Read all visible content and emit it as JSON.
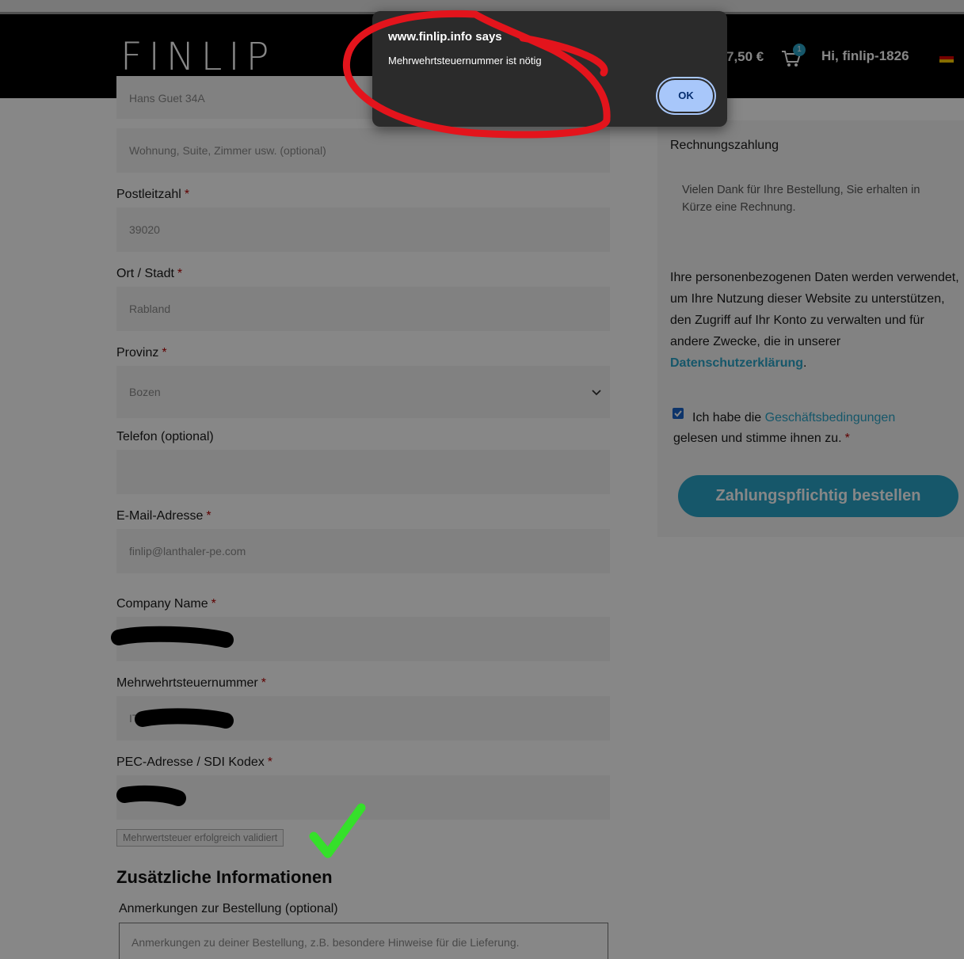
{
  "header": {
    "logo": "FINLIP",
    "cart_total": "7,50 €",
    "cart_count": "1",
    "greeting": "Hi, finlip-1826",
    "language_flag": "german-flag-icon"
  },
  "form": {
    "address_line1_value": "Hans Guet 34A",
    "address_line2_placeholder": "Wohnung, Suite, Zimmer usw. (optional)",
    "postcode_label": "Postleitzahl",
    "postcode_value": "39020",
    "city_label": "Ort / Stadt",
    "city_value": "Rabland",
    "province_label": "Provinz",
    "province_value": "Bozen",
    "phone_label": "Telefon (optional)",
    "email_label": "E-Mail-Adresse",
    "email_value": "finlip@lanthaler-pe.com",
    "company_label": "Company Name",
    "vat_label": "Mehrwehrtsteuernummer",
    "vat_value_prefix": "IT",
    "pec_label": "PEC-Adresse / SDI Kodex",
    "required_mark": "*",
    "validation_badge": "Mehrwertsteuer erfolgreich validiert",
    "additional_title": "Zusätzliche Informationen",
    "notes_label": "Anmerkungen zur Bestellung (optional)",
    "notes_placeholder": "Anmerkungen zu deiner Bestellung, z.B. besondere Hinweise für die Lieferung."
  },
  "sidebar": {
    "payment_title": "Rechnungszahlung",
    "payment_desc": "Vielen Dank für Ihre Bestellung, Sie erhalten in Kürze eine Rechnung.",
    "privacy_text": "Ihre personenbezogenen Daten werden verwendet, um Ihre Nutzung dieser Website zu unterstützen, den Zugriff auf Ihr Konto zu verwalten und für andere Zwecke, die in unserer",
    "privacy_link": "Datenschutzerklärung",
    "privacy_end": ".",
    "terms_prefix": "Ich habe die",
    "terms_link": "Geschäftsbedingungen",
    "terms_suffix": "gelesen und stimme ihnen zu.",
    "order_button": "Zahlungspflichtig bestellen"
  },
  "dialog": {
    "title": "www.finlip.info says",
    "message": "Mehrwehrtsteuernummer ist nötig",
    "ok_label": "OK"
  },
  "colors": {
    "accent": "#2aa4c8",
    "header_bg": "#000000",
    "annotation_red": "#e3141c",
    "annotation_green": "#35e02a"
  }
}
